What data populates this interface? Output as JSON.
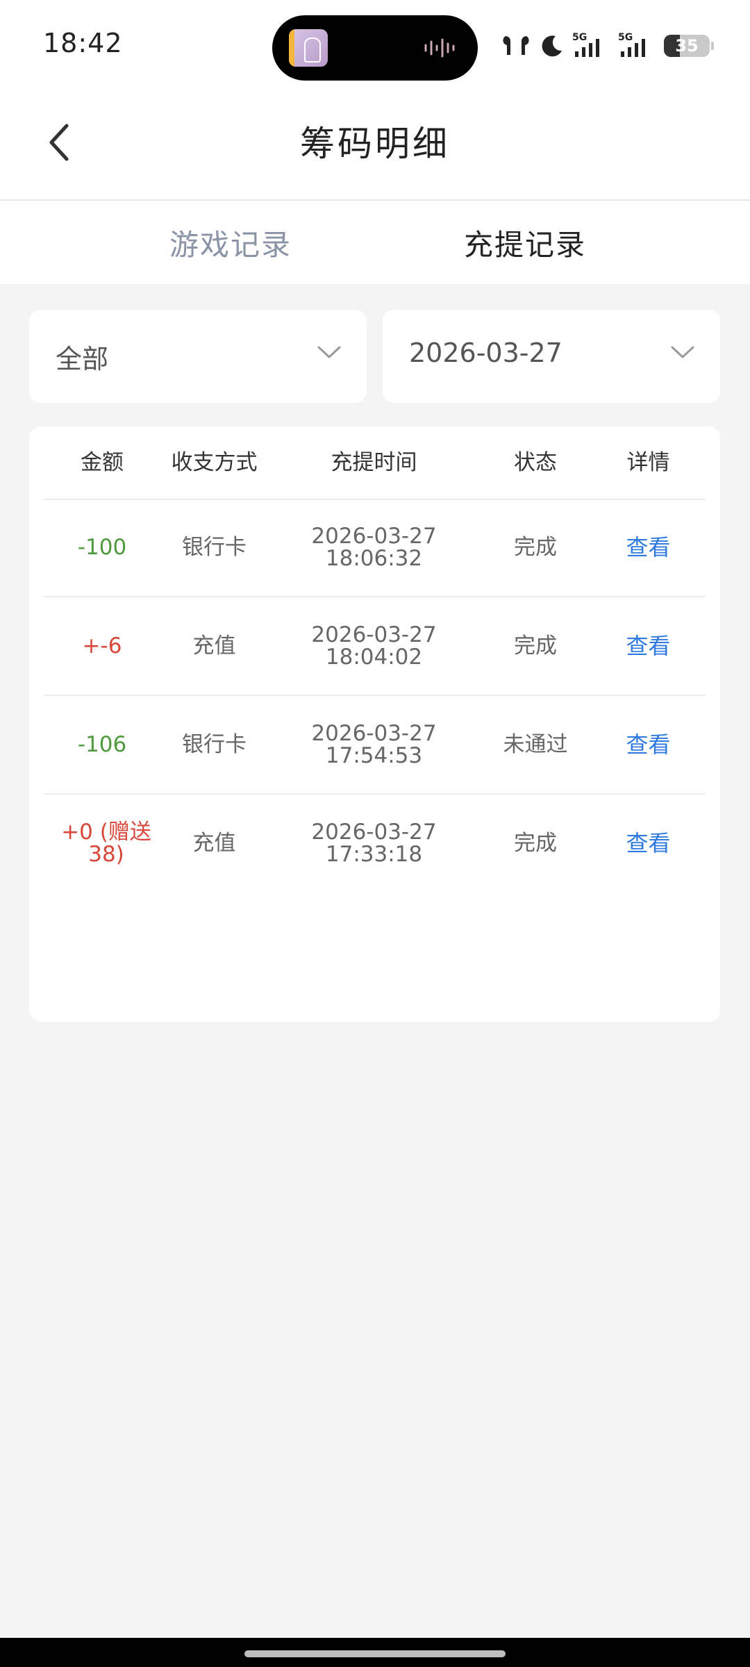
{
  "status_bar": {
    "time": "18:42",
    "network_1": "5G",
    "network_2": "5G",
    "battery": "35"
  },
  "header": {
    "title": "筹码明细"
  },
  "tabs": [
    {
      "label": "游戏记录",
      "active": false
    },
    {
      "label": "充提记录",
      "active": true
    }
  ],
  "filters": {
    "type": "全部",
    "date": "2026-03-27"
  },
  "table": {
    "columns": [
      "金额",
      "收支方式",
      "充提时间",
      "状态",
      "详情"
    ],
    "rows": [
      {
        "amount": "-100",
        "method": "银行卡",
        "date": "2026-03-27",
        "time": "18:06:32",
        "status": "完成",
        "detail": "查看"
      },
      {
        "amount": "+-6",
        "method": "充值",
        "date": "2026-03-27",
        "time": "18:04:02",
        "status": "完成",
        "detail": "查看"
      },
      {
        "amount": "-106",
        "method": "银行卡",
        "date": "2026-03-27",
        "time": "17:54:53",
        "status": "未通过",
        "detail": "查看"
      },
      {
        "amount": "+0 (赠送38)",
        "method": "充值",
        "date": "2026-03-27",
        "time": "17:33:18",
        "status": "完成",
        "detail": "查看"
      }
    ]
  },
  "colors": {
    "negative_amount": "#4f9a3d",
    "positive_amount": "#d9473a",
    "link": "#2f7ae0",
    "inactive_tab": "#8b94a6"
  }
}
